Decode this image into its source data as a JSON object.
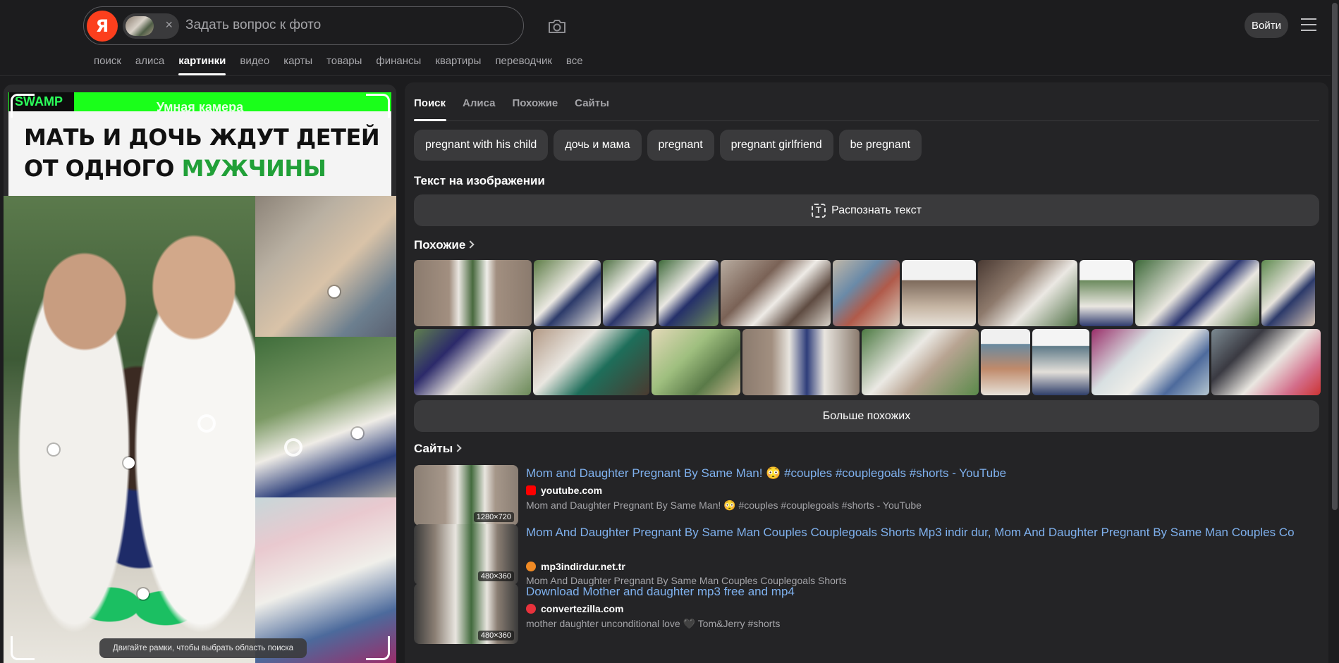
{
  "header": {
    "logo_letter": "Я",
    "search_placeholder": "Задать вопрос к фото",
    "clear_symbol": "×",
    "login_label": "Войти",
    "icons": [
      "camera-icon",
      "hamburger-menu-icon"
    ]
  },
  "nav": {
    "items": [
      "поиск",
      "алиса",
      "картинки",
      "видео",
      "карты",
      "товары",
      "финансы",
      "квартиры",
      "переводчик",
      "все"
    ],
    "active": "картинки"
  },
  "image_pane": {
    "brand": "SWAMP",
    "overlay_title": "Умная камера",
    "headline_part1": "МАТЬ И ДОЧЬ ЖДУТ ДЕТЕЙ ОТ ОДНОГО ",
    "headline_part2": "МУЖЧИНЫ",
    "hint": "Двигайте рамки, чтобы выбрать область поиска",
    "accent_color": "#1aff1a"
  },
  "tabs": {
    "items": [
      "Поиск",
      "Алиса",
      "Похожие",
      "Сайты"
    ],
    "active": "Поиск"
  },
  "chips": [
    "pregnant with his child",
    "дочь и мама",
    "pregnant",
    "pregnant girlfriend",
    "be pregnant"
  ],
  "text_section": {
    "title": "Текст на изображении",
    "button": "Распознать текст"
  },
  "similar": {
    "title": "Похожие",
    "more_button": "Больше похожих"
  },
  "sites": {
    "title": "Сайты",
    "items": [
      {
        "title": "Mom and Daughter Pregnant By Same Man! 😳 #couples #couplegoals #shorts - YouTube",
        "domain": "youtube.com",
        "desc": "Mom and Daughter Pregnant By Same Man! 😳 #couples #couplegoals #shorts - YouTube",
        "res": "1280×720",
        "fav_color": "#ff0000"
      },
      {
        "title": "Mom And Daughter Pregnant By Same Man Couples Couplegoals Shorts Mp3 indir dur, Mom And Daughter Pregnant By Same Man Couples Co",
        "domain": "mp3indirdur.net.tr",
        "desc": "Mom And Daughter Pregnant By Same Man Couples Couplegoals Shorts",
        "res": "480×360",
        "fav_color": "#f08a24"
      },
      {
        "title": "Download Mother and daughter mp3 free and mp4",
        "domain": "convertezilla.com",
        "desc": "mother daughter unconditional love 🖤 Tom&Jerry #shorts",
        "res": "480×360",
        "fav_color": "#e8323c"
      }
    ]
  }
}
